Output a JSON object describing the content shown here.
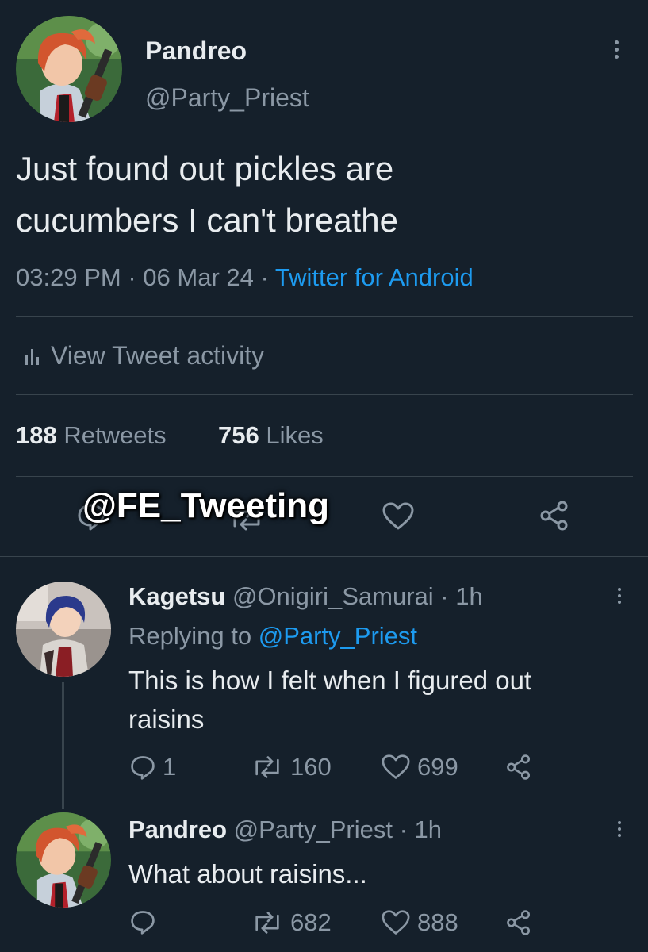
{
  "main_tweet": {
    "display_name": "Pandreo",
    "handle": "@Party_Priest",
    "text_line1": "Just found out pickles are",
    "text_line2": "cucumbers I can't breathe",
    "time": "03:29 PM",
    "sep1": "·",
    "date": "06 Mar 24",
    "sep2": "·",
    "source": "Twitter for Android",
    "activity_label": "View Tweet activity",
    "retweets_count": "188",
    "retweets_label": "Retweets",
    "likes_count": "756",
    "likes_label": "Likes"
  },
  "watermark": "@FE_Tweeting",
  "replies": [
    {
      "display_name": "Kagetsu",
      "handle": "@Onigiri_Samurai",
      "time": "· 1h",
      "replying_prefix": "Replying to",
      "replying_to": "@Party_Priest",
      "text_line1": "This is how I felt when I figured out",
      "text_line2": "raisins",
      "reply_count": "1",
      "retweet_count": "160",
      "like_count": "699"
    },
    {
      "display_name": "Pandreo",
      "handle": "@Party_Priest",
      "time": "· 1h",
      "text_line1": "What about raisins...",
      "reply_count": "",
      "retweet_count": "682",
      "like_count": "888"
    }
  ],
  "colors": {
    "background": "#15202b",
    "text": "#e8ecef",
    "muted": "#8b98a5",
    "link": "#1d9bf0",
    "divider": "#38444d"
  },
  "icons": [
    "more-vertical-icon",
    "bar-chart-icon",
    "reply-icon",
    "retweet-icon",
    "like-icon",
    "share-icon"
  ]
}
